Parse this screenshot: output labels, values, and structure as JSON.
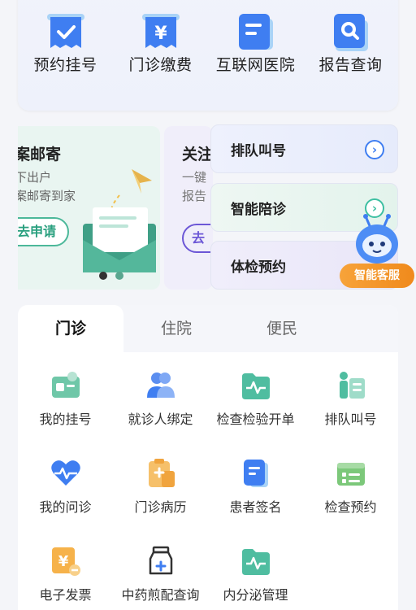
{
  "quick_actions": [
    {
      "label": "预约挂号",
      "icon": "calendar-check-icon"
    },
    {
      "label": "门诊缴费",
      "icon": "yuan-receipt-icon"
    },
    {
      "label": "互联网医院",
      "icon": "document-icon"
    },
    {
      "label": "报告查询",
      "icon": "search-report-icon"
    }
  ],
  "banner": {
    "title": "案邮寄",
    "line1": "下出户",
    "line2": "案邮寄到家",
    "button": "去申请"
  },
  "banner2": {
    "title": "关注",
    "line1": "一键",
    "line2": "报告",
    "button": "去"
  },
  "side_cards": [
    {
      "label": "排队叫号",
      "icon": "chevron-right-icon"
    },
    {
      "label": "智能陪诊",
      "icon": "chevron-right-icon"
    },
    {
      "label": "体检预约",
      "icon": "chevron-right-icon"
    }
  ],
  "assistant": {
    "label": "智能客服"
  },
  "tabs": [
    "门诊",
    "住院",
    "便民"
  ],
  "services": [
    {
      "label": "我的挂号",
      "icon": "id-card-icon"
    },
    {
      "label": "就诊人绑定",
      "icon": "users-icon"
    },
    {
      "label": "检查检验开单",
      "icon": "folder-pulse-icon"
    },
    {
      "label": "排队叫号",
      "icon": "queue-icon"
    },
    {
      "label": "我的问诊",
      "icon": "heart-pulse-icon"
    },
    {
      "label": "门诊病历",
      "icon": "clipboard-icon"
    },
    {
      "label": "患者签名",
      "icon": "sign-document-icon"
    },
    {
      "label": "检查预约",
      "icon": "checklist-icon"
    },
    {
      "label": "电子发票",
      "icon": "invoice-icon"
    },
    {
      "label": "中药煎配查询",
      "icon": "medicine-bottle-icon"
    },
    {
      "label": "内分泌管理",
      "icon": "folder-pulse-icon"
    }
  ],
  "colors": {
    "blue": "#3f7ef1",
    "teal": "#3ebfa2",
    "orange": "#f49a2a",
    "purple": "#6c57d6"
  }
}
